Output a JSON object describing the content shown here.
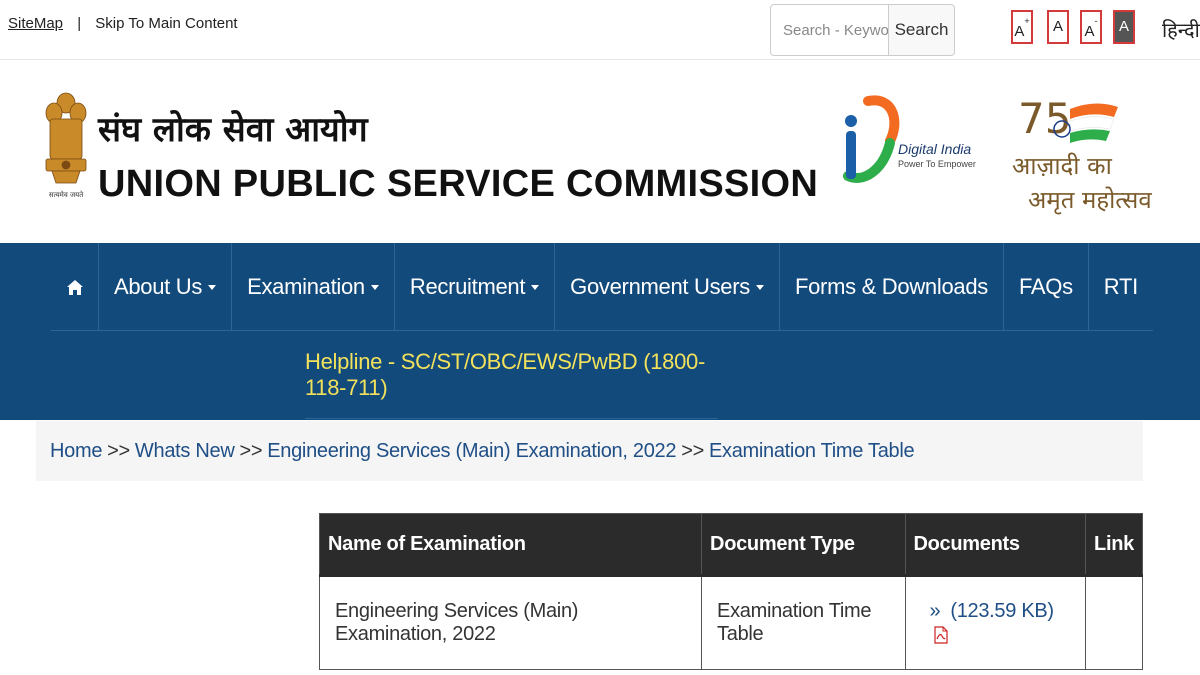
{
  "utility": {
    "sitemap": "SiteMap",
    "separator": "|",
    "skip": "Skip To Main Content"
  },
  "search": {
    "placeholder": "Search - Keyword",
    "button": "Search"
  },
  "font_controls": [
    {
      "label": "A",
      "sup": "+"
    },
    {
      "label": "A",
      "sup": ""
    },
    {
      "label": "A",
      "sup": "-"
    },
    {
      "label": "A",
      "sup": ""
    }
  ],
  "language": "हिन्दी",
  "header": {
    "title_hindi": "संघ लोक सेवा आयोग",
    "title_english": "UNION PUBLIC SERVICE COMMISSION",
    "emblem_motto": "सत्यमेव जयते",
    "digital_india": "Digital India",
    "digital_india_tagline": "Power To Empower",
    "azadi_line1": "आज़ादी का",
    "azadi_line2": "अमृत महोत्सव",
    "azadi_number": "75"
  },
  "nav": {
    "items": [
      {
        "label": "About Us",
        "dropdown": true
      },
      {
        "label": "Examination",
        "dropdown": true
      },
      {
        "label": "Recruitment",
        "dropdown": true
      },
      {
        "label": "Government Users",
        "dropdown": true
      },
      {
        "label": "Forms & Downloads",
        "dropdown": false
      },
      {
        "label": "FAQs",
        "dropdown": false
      },
      {
        "label": "RTI",
        "dropdown": false
      }
    ],
    "helpline": "Helpline - SC/ST/OBC/EWS/PwBD (1800-118-711)"
  },
  "breadcrumb": {
    "items": [
      "Home",
      "Whats New",
      "Engineering Services (Main) Examination, 2022",
      "Examination Time Table"
    ],
    "separator": ">>"
  },
  "table": {
    "headers": [
      "Name of Examination",
      "Document Type",
      "Documents",
      "Link"
    ],
    "rows": [
      {
        "name": "Engineering Services (Main) Examination, 2022",
        "type": "Examination Time Table",
        "doc_marker": "»",
        "doc_size": "(123.59 KB)",
        "link": ""
      }
    ]
  },
  "colors": {
    "nav_bg": "#134a7c",
    "helpline_text": "#f2e15b",
    "link": "#1f4f86",
    "table_header": "#2b2b2b"
  }
}
